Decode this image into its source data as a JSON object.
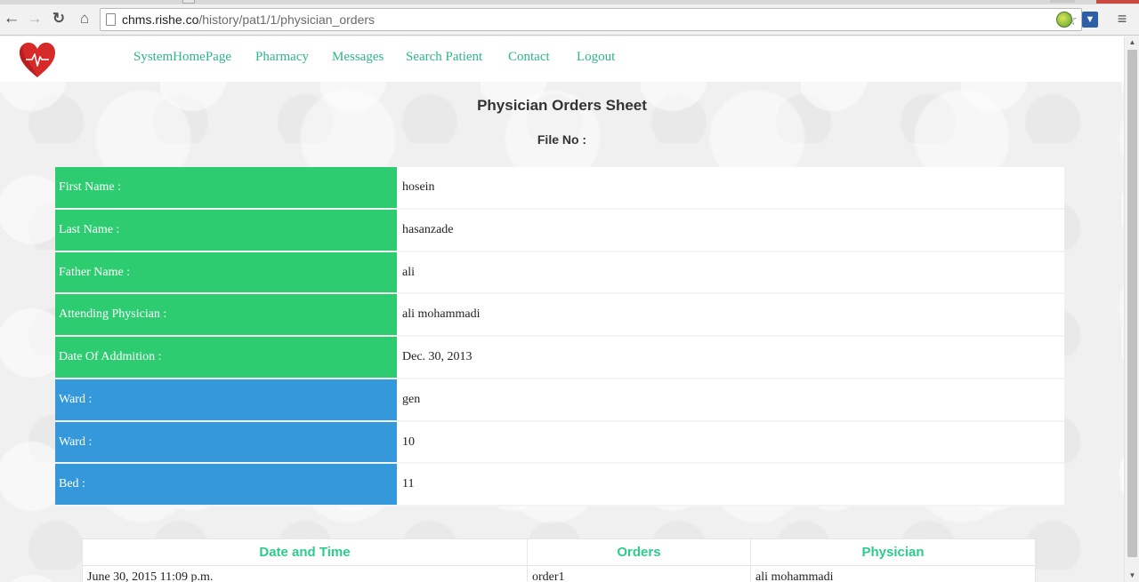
{
  "browser": {
    "url_host": "chms.rishe.co",
    "url_path": "/history/pat1/1/physician_orders"
  },
  "nav": {
    "links": [
      "SystemHomePage",
      "Pharmacy",
      "Messages",
      "Search Patient",
      "Contact",
      "Logout"
    ]
  },
  "sheet": {
    "title": "Physician Orders Sheet",
    "file_no": "File No :"
  },
  "patient": [
    {
      "label": "First Name :",
      "value": "hosein",
      "color": "#2ecc71"
    },
    {
      "label": "Last Name :",
      "value": "hasanzade",
      "color": "#2ecc71"
    },
    {
      "label": "Father Name :",
      "value": "ali",
      "color": "#2ecc71"
    },
    {
      "label": "Attending Physician :",
      "value": "ali mohammadi",
      "color": "#2ecc71"
    },
    {
      "label": "Date Of Addmition :",
      "value": "Dec. 30, 2013",
      "color": "#2ecc71"
    },
    {
      "label": "Ward :",
      "value": "gen",
      "color": "#3498db"
    },
    {
      "label": "Ward :",
      "value": "10",
      "color": "#3498db"
    },
    {
      "label": "Bed :",
      "value": "11",
      "color": "#3498db"
    }
  ],
  "orders": {
    "headers": [
      "Date and Time",
      "Orders",
      "Physician"
    ],
    "rows": [
      [
        "June 30, 2015 11:09 p.m.",
        "order1",
        "ali mohammadi"
      ]
    ]
  },
  "colors": {
    "accent": "#2ecc71",
    "ward": "#3498db",
    "link": "#2fb58a"
  }
}
